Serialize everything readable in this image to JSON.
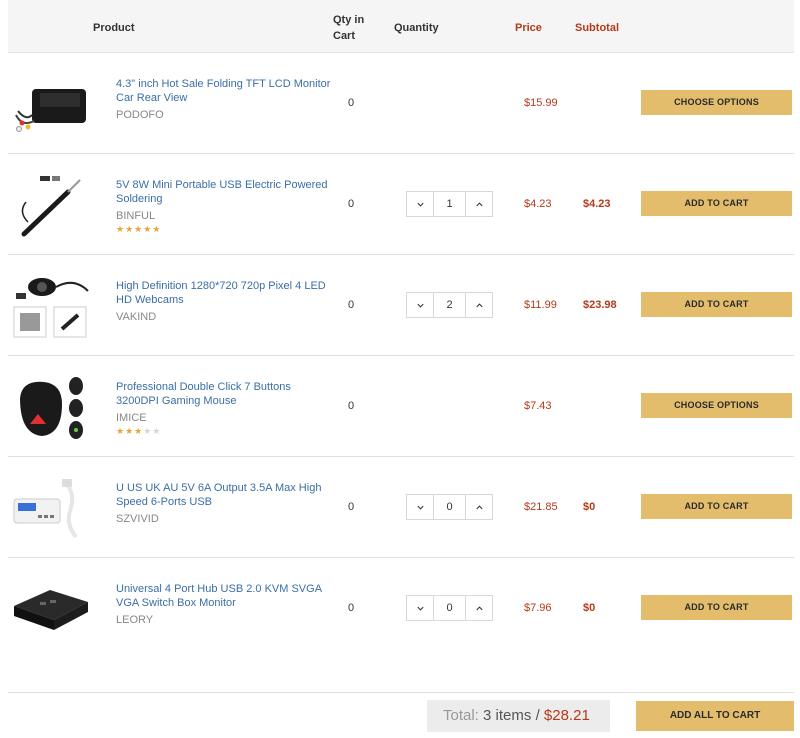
{
  "header": {
    "product": "Product",
    "qty_in_cart": "Qty in Cart",
    "quantity": "Quantity",
    "price": "Price",
    "subtotal": "Subtotal"
  },
  "rows": [
    {
      "name": "4.3\" inch Hot Sale Folding TFT LCD Monitor Car Rear View",
      "brand": "PODOFO",
      "rating": 0,
      "qty_in_cart": "0",
      "quantity": "",
      "price": "$15.99",
      "subtotal": "",
      "button": "CHOOSE OPTIONS",
      "image_icon": "car-monitor-image"
    },
    {
      "name": "5V 8W Mini Portable USB Electric Powered Soldering",
      "brand": "BINFUL",
      "rating": 5,
      "qty_in_cart": "0",
      "quantity": "1",
      "price": "$4.23",
      "subtotal": "$4.23",
      "button": "ADD TO CART",
      "image_icon": "soldering-iron-image"
    },
    {
      "name": "High Definition 1280*720 720p Pixel 4 LED HD Webcams",
      "brand": "VAKIND",
      "rating": 0,
      "qty_in_cart": "0",
      "quantity": "2",
      "price": "$11.99",
      "subtotal": "$23.98",
      "button": "ADD TO CART",
      "image_icon": "webcam-image"
    },
    {
      "name": "Professional Double Click 7 Buttons 3200DPI Gaming Mouse",
      "brand": "IMICE",
      "rating": 3,
      "qty_in_cart": "0",
      "quantity": "",
      "price": "$7.43",
      "subtotal": "",
      "button": "CHOOSE OPTIONS",
      "image_icon": "gaming-mouse-image"
    },
    {
      "name": "U US UK AU 5V 6A Output 3.5A Max High Speed 6-Ports USB",
      "brand": "SZVIVID",
      "rating": 0,
      "qty_in_cart": "0",
      "quantity": "0",
      "price": "$21.85",
      "subtotal": "$0",
      "button": "ADD TO CART",
      "image_icon": "usb-charger-image"
    },
    {
      "name": "Universal 4 Port Hub USB 2.0 KVM SVGA VGA Switch Box Monitor",
      "brand": "LEORY",
      "rating": 0,
      "qty_in_cart": "0",
      "quantity": "0",
      "price": "$7.96",
      "subtotal": "$0",
      "button": "ADD TO CART",
      "image_icon": "kvm-switch-image"
    }
  ],
  "footer": {
    "total_label": "Total:",
    "items": "3 items",
    "separator": "/",
    "amount": "$28.21",
    "add_all": "ADD ALL TO CART"
  },
  "colors": {
    "accent_button": "#e3bd6c",
    "price": "#b33a1a",
    "link": "#3a6ea5",
    "star": "#e8a33d"
  }
}
